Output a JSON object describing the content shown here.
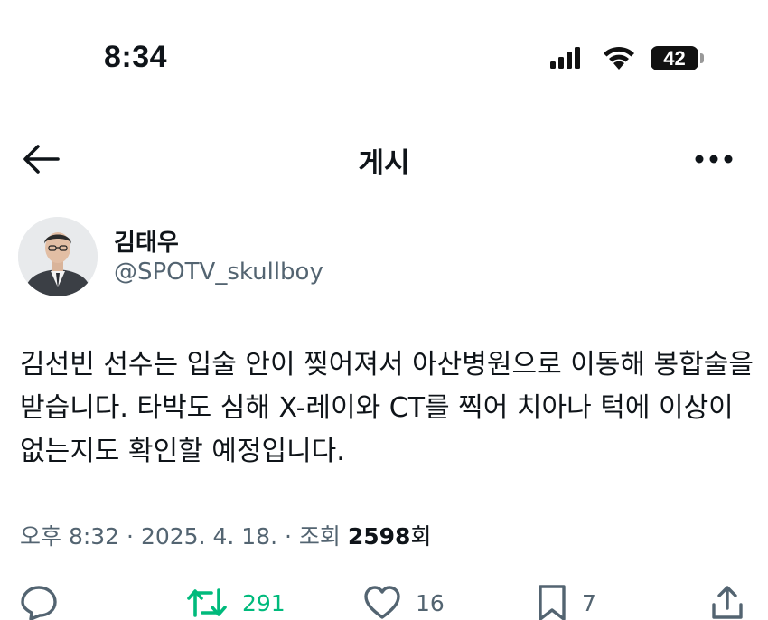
{
  "status_bar": {
    "time": "8:34",
    "battery_level": "42"
  },
  "header": {
    "title": "게시"
  },
  "author": {
    "name": "김태우",
    "handle": "@SPOTV_skullboy"
  },
  "post": {
    "text": "김선빈 선수는 입술 안이 찢어져서 아산병원으로 이동해 봉합술을 받습니다. 타박도 심해 X-레이와 CT를 찍어 치아나 턱에 이상이 없는지도 확인할 예정입니다.",
    "time": "오후 8:32",
    "separator": "·",
    "date": "2025. 4. 18.",
    "views_label": "조회",
    "views_count": "2598",
    "views_unit": "회"
  },
  "actions": {
    "reply_icon": "reply-icon",
    "retweet_count": "291",
    "like_count": "16",
    "bookmark_count": "7",
    "share_icon": "share-icon"
  },
  "colors": {
    "text": "#0f1419",
    "secondary": "#536471",
    "retweet_green": "#00ba7c"
  }
}
